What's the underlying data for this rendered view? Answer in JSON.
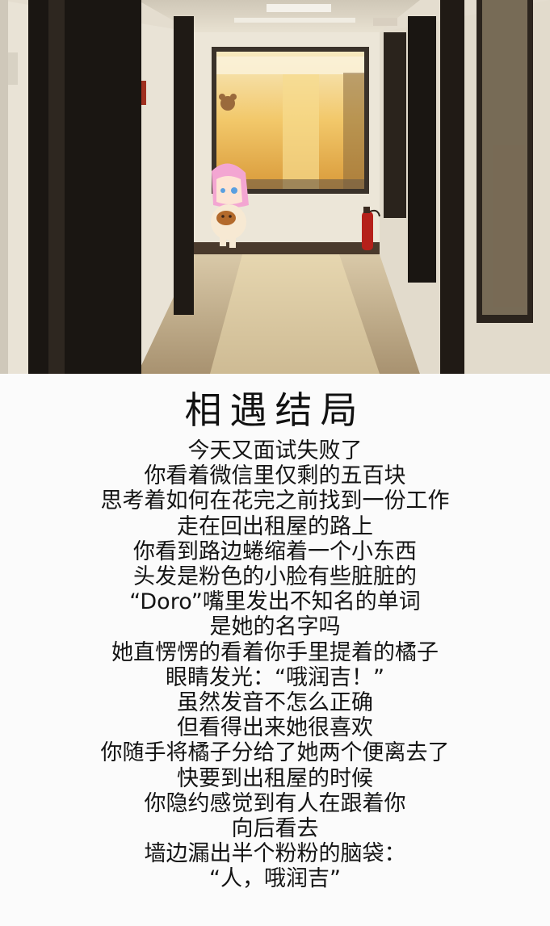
{
  "story": {
    "title": "相遇结局",
    "lines": [
      "今天又面试失败了",
      "你看着微信里仅剩的五百块",
      "思考着如何在花完之前找到一份工作",
      "走在回出租屋的路上",
      "你看到路边蜷缩着一个小东西",
      "头发是粉色的小脸有些脏脏的",
      "“Doro”嘴里发出不知名的单词",
      "是她的名字吗",
      "她直愣愣的看着你手里提着的橘子",
      "眼睛发光：“哦润吉！”",
      "虽然发音不怎么正确",
      "但看得出来她很喜欢",
      "你随手将橘子分给了她两个便离去了",
      "快要到出租屋的时候",
      "你隐约感觉到有人在跟着你",
      "向后看去",
      "墙边漏出半个粉粉的脑袋：",
      "“人，哦润吉”"
    ]
  },
  "colors": {
    "sunlight": "#f2c86a",
    "wall": "#e9e3d6",
    "door": "#1a1612",
    "doro_hair": "#f3a6d2",
    "caption_bg": "#fbfbfb"
  },
  "photo": {
    "icons": [
      "hallway-photo",
      "doro-character-icon",
      "fire-extinguisher-icon",
      "wall-sticker-icon"
    ]
  }
}
